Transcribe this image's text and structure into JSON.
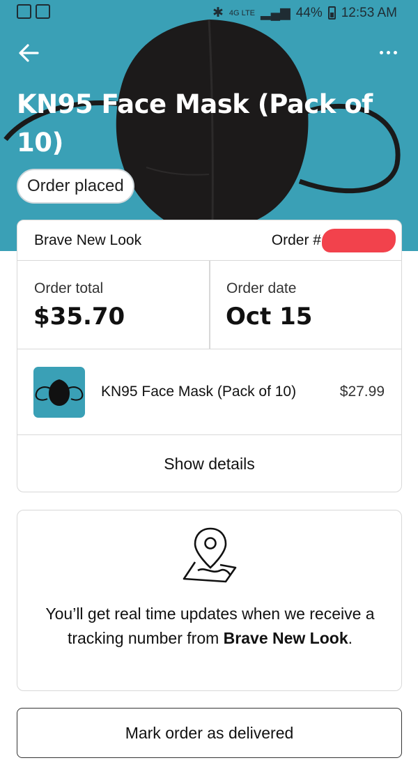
{
  "status_bar": {
    "battery": "44%",
    "time": "12:53 AM",
    "network": "4G LTE"
  },
  "header": {
    "title": "KN95 Face Mask (Pack of 10)",
    "status": "Order placed",
    "back_icon": "arrow-left-icon",
    "more_icon": "more-horizontal-icon"
  },
  "order": {
    "merchant": "Brave New Look",
    "order_number_label": "Order #",
    "total_label": "Order total",
    "total_value": "$35.70",
    "date_label": "Order date",
    "date_value": "Oct 15",
    "item": {
      "name": "KN95 Face Mask (Pack of 10)",
      "price": "$27.99"
    },
    "show_details": "Show details"
  },
  "tracking": {
    "icon": "map-pin-icon",
    "text_prefix": "You’ll get real time updates when we receive a tracking number from ",
    "merchant": "Brave New Look",
    "text_suffix": "."
  },
  "actions": {
    "mark_delivered": "Mark order as delivered"
  },
  "colors": {
    "hero_background": "#3aa0b6",
    "redaction": "#f2424c"
  }
}
